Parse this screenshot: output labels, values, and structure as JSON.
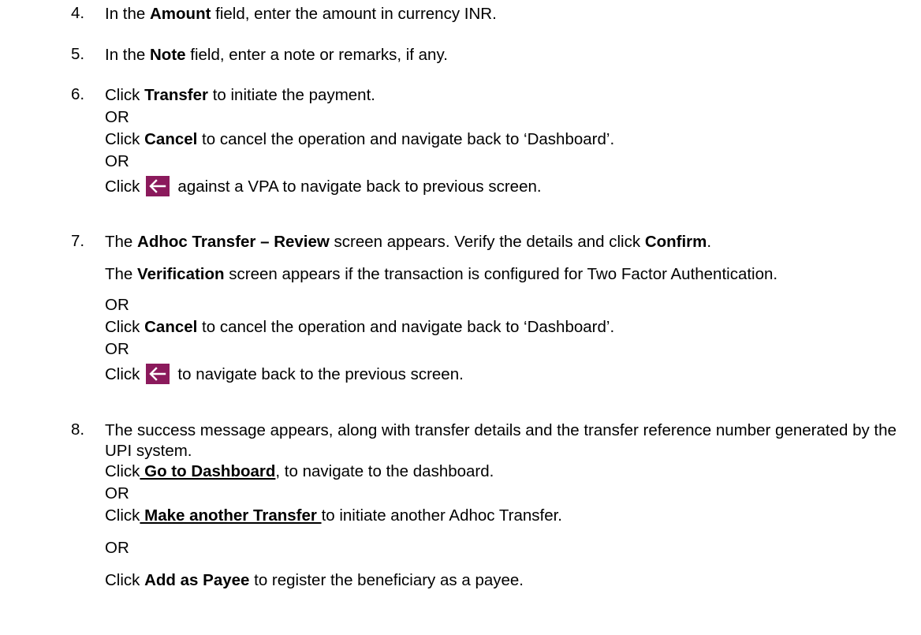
{
  "steps": [
    {
      "num": "4.",
      "pre": "In the ",
      "b1": "Amount",
      "post": " field, enter the amount in currency INR."
    },
    {
      "num": "5.",
      "pre": "In the ",
      "b1": "Note",
      "post": " field, enter a note or remarks, if any."
    },
    {
      "num": "6.",
      "l1_pre": "Click ",
      "l1_b": "Transfer",
      "l1_post": " to initiate the payment.",
      "or": "OR",
      "l2_pre": "Click ",
      "l2_b": "Cancel",
      "l2_post": " to cancel the operation and navigate back to ‘Dashboard’.",
      "l3_pre": "Click",
      "l3_post": "against a VPA to navigate back to previous screen."
    },
    {
      "num": "7.",
      "l1_pre": "The ",
      "l1_b": "Adhoc Transfer – Review",
      "l1_mid": " screen appears. Verify the details and click ",
      "l1_b2": "Confirm",
      "l1_post": ".",
      "p_pre": "The ",
      "p_b": "Verification",
      "p_post": " screen appears if the transaction is configured for Two Factor Authentication.",
      "or": "OR",
      "l2_pre": "Click ",
      "l2_b": "Cancel",
      "l2_post": " to cancel the operation and navigate back to ‘Dashboard’.",
      "l3_pre": "Click",
      "l3_post": "to navigate back to the previous screen."
    },
    {
      "num": "8.",
      "p": "The success message appears, along with transfer details and the transfer reference number generated by the UPI system.",
      "l1_pre": "Click",
      "l1_link": " Go to Dashboard",
      "l1_post": ", to navigate to the dashboard.",
      "or": "OR",
      "l2_pre": "Click",
      "l2_link": " Make another Transfer ",
      "l2_post": "to initiate another Adhoc Transfer.",
      "l3_pre": "Click ",
      "l3_b": "Add as Payee",
      "l3_post": " to register the beneficiary as a payee."
    }
  ],
  "icons": {
    "back": "arrow-left-icon",
    "back_color": "#8b1a5c"
  }
}
